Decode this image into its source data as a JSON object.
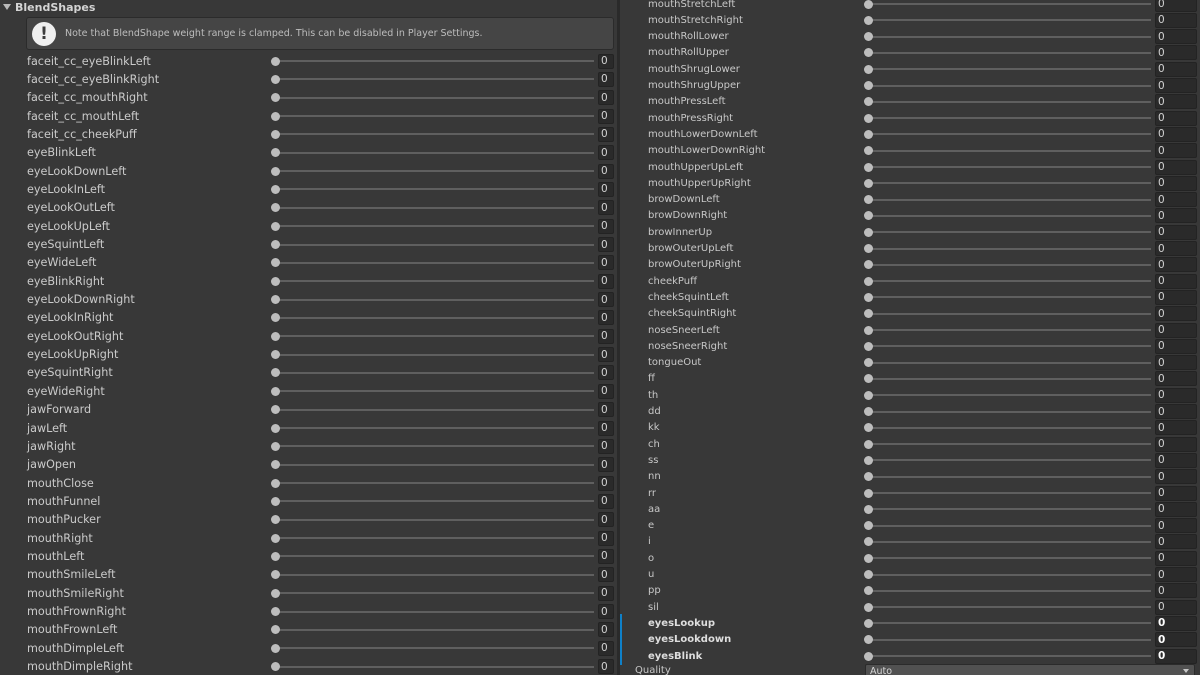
{
  "header": {
    "title": "BlendShapes"
  },
  "help": {
    "text": "Note that BlendShape weight range is clamped. This can be disabled in Player Settings."
  },
  "left_rows": [
    {
      "label": "faceit_cc_eyeBlinkLeft",
      "value": "0"
    },
    {
      "label": "faceit_cc_eyeBlinkRight",
      "value": "0"
    },
    {
      "label": "faceit_cc_mouthRight",
      "value": "0"
    },
    {
      "label": "faceit_cc_mouthLeft",
      "value": "0"
    },
    {
      "label": "faceit_cc_cheekPuff",
      "value": "0"
    },
    {
      "label": "eyeBlinkLeft",
      "value": "0"
    },
    {
      "label": "eyeLookDownLeft",
      "value": "0"
    },
    {
      "label": "eyeLookInLeft",
      "value": "0"
    },
    {
      "label": "eyeLookOutLeft",
      "value": "0"
    },
    {
      "label": "eyeLookUpLeft",
      "value": "0"
    },
    {
      "label": "eyeSquintLeft",
      "value": "0"
    },
    {
      "label": "eyeWideLeft",
      "value": "0"
    },
    {
      "label": "eyeBlinkRight",
      "value": "0"
    },
    {
      "label": "eyeLookDownRight",
      "value": "0"
    },
    {
      "label": "eyeLookInRight",
      "value": "0"
    },
    {
      "label": "eyeLookOutRight",
      "value": "0"
    },
    {
      "label": "eyeLookUpRight",
      "value": "0"
    },
    {
      "label": "eyeSquintRight",
      "value": "0"
    },
    {
      "label": "eyeWideRight",
      "value": "0"
    },
    {
      "label": "jawForward",
      "value": "0"
    },
    {
      "label": "jawLeft",
      "value": "0"
    },
    {
      "label": "jawRight",
      "value": "0"
    },
    {
      "label": "jawOpen",
      "value": "0"
    },
    {
      "label": "mouthClose",
      "value": "0"
    },
    {
      "label": "mouthFunnel",
      "value": "0"
    },
    {
      "label": "mouthPucker",
      "value": "0"
    },
    {
      "label": "mouthRight",
      "value": "0"
    },
    {
      "label": "mouthLeft",
      "value": "0"
    },
    {
      "label": "mouthSmileLeft",
      "value": "0"
    },
    {
      "label": "mouthSmileRight",
      "value": "0"
    },
    {
      "label": "mouthFrownRight",
      "value": "0"
    },
    {
      "label": "mouthFrownLeft",
      "value": "0"
    },
    {
      "label": "mouthDimpleLeft",
      "value": "0"
    },
    {
      "label": "mouthDimpleRight",
      "value": "0"
    }
  ],
  "right_rows": [
    {
      "label": "mouthStretchLeft",
      "value": "0"
    },
    {
      "label": "mouthStretchRight",
      "value": "0"
    },
    {
      "label": "mouthRollLower",
      "value": "0"
    },
    {
      "label": "mouthRollUpper",
      "value": "0"
    },
    {
      "label": "mouthShrugLower",
      "value": "0"
    },
    {
      "label": "mouthShrugUpper",
      "value": "0"
    },
    {
      "label": "mouthPressLeft",
      "value": "0"
    },
    {
      "label": "mouthPressRight",
      "value": "0"
    },
    {
      "label": "mouthLowerDownLeft",
      "value": "0"
    },
    {
      "label": "mouthLowerDownRight",
      "value": "0"
    },
    {
      "label": "mouthUpperUpLeft",
      "value": "0"
    },
    {
      "label": "mouthUpperUpRight",
      "value": "0"
    },
    {
      "label": "browDownLeft",
      "value": "0"
    },
    {
      "label": "browDownRight",
      "value": "0"
    },
    {
      "label": "browInnerUp",
      "value": "0"
    },
    {
      "label": "browOuterUpLeft",
      "value": "0"
    },
    {
      "label": "browOuterUpRight",
      "value": "0"
    },
    {
      "label": "cheekPuff",
      "value": "0"
    },
    {
      "label": "cheekSquintLeft",
      "value": "0"
    },
    {
      "label": "cheekSquintRight",
      "value": "0"
    },
    {
      "label": "noseSneerLeft",
      "value": "0"
    },
    {
      "label": "noseSneerRight",
      "value": "0"
    },
    {
      "label": "tongueOut",
      "value": "0"
    },
    {
      "label": "ff",
      "value": "0"
    },
    {
      "label": "th",
      "value": "0"
    },
    {
      "label": "dd",
      "value": "0"
    },
    {
      "label": "kk",
      "value": "0"
    },
    {
      "label": "ch",
      "value": "0"
    },
    {
      "label": "ss",
      "value": "0"
    },
    {
      "label": "nn",
      "value": "0"
    },
    {
      "label": "rr",
      "value": "0"
    },
    {
      "label": "aa",
      "value": "0"
    },
    {
      "label": "e",
      "value": "0"
    },
    {
      "label": "i",
      "value": "0"
    },
    {
      "label": "o",
      "value": "0"
    },
    {
      "label": "u",
      "value": "0"
    },
    {
      "label": "pp",
      "value": "0"
    },
    {
      "label": "sil",
      "value": "0"
    },
    {
      "label": "eyesLookup",
      "value": "0",
      "overridden": true
    },
    {
      "label": "eyesLookdown",
      "value": "0",
      "overridden": true
    },
    {
      "label": "eyesBlink",
      "value": "0",
      "overridden": true
    }
  ],
  "quality": {
    "label": "Quality",
    "value": "Auto"
  },
  "colors": {
    "background": "#383838",
    "override_accent": "#0f81c9"
  }
}
